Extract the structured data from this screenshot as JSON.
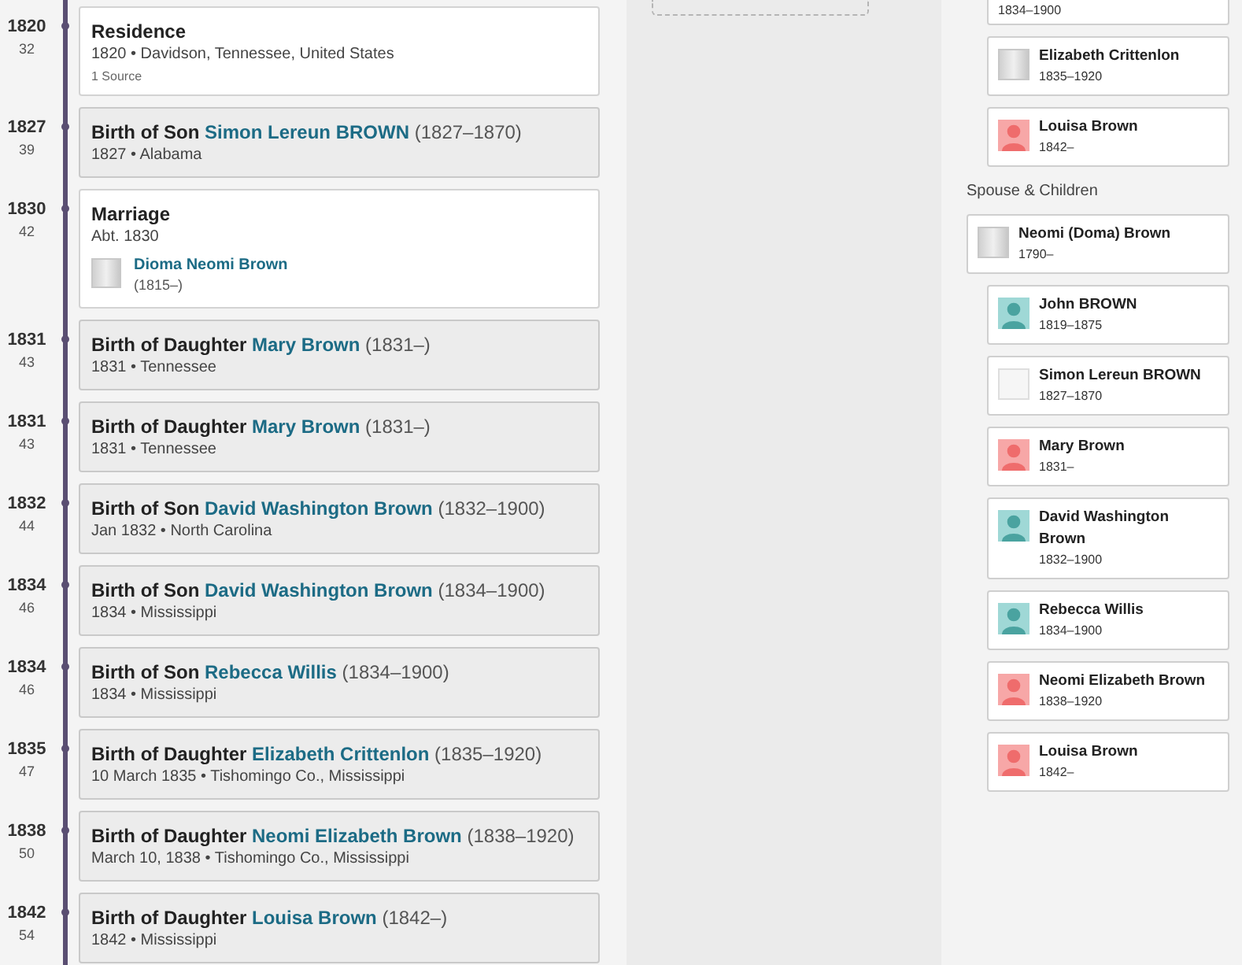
{
  "timeline": [
    {
      "year": "1820",
      "age": "32",
      "kind": "residence",
      "title": "Residence",
      "detail": "1820 • Davidson, Tennessee, United States",
      "sources": "1 Source"
    },
    {
      "year": "1827",
      "age": "39",
      "kind": "birth",
      "title": "Birth of Son",
      "person": "Simon Lereun BROWN",
      "years": "(1827–1870)",
      "detail": "1827 • Alabama"
    },
    {
      "year": "1830",
      "age": "42",
      "kind": "marriage",
      "title": "Marriage",
      "detail": "Abt. 1830",
      "spouse": {
        "name": "Dioma Neomi Brown",
        "years": "(1815–)",
        "kind": "photo"
      }
    },
    {
      "year": "1831",
      "age": "43",
      "kind": "birth",
      "title": "Birth of Daughter",
      "person": "Mary Brown",
      "years": "(1831–)",
      "detail": "1831 • Tennessee"
    },
    {
      "year": "1831",
      "age": "43",
      "kind": "birth",
      "title": "Birth of Daughter",
      "person": "Mary Brown",
      "years": "(1831–)",
      "detail": "1831 • Tennessee"
    },
    {
      "year": "1832",
      "age": "44",
      "kind": "birth",
      "title": "Birth of Son",
      "person": "David Washington Brown",
      "years": "(1832–1900)",
      "detail": "Jan 1832 • North Carolina"
    },
    {
      "year": "1834",
      "age": "46",
      "kind": "birth",
      "title": "Birth of Son",
      "person": "David Washington Brown",
      "years": "(1834–1900)",
      "detail": "1834 • Mississippi"
    },
    {
      "year": "1834",
      "age": "46",
      "kind": "birth",
      "title": "Birth of Son",
      "person": "Rebecca Willis",
      "years": "(1834–1900)",
      "detail": "1834 • Mississippi"
    },
    {
      "year": "1835",
      "age": "47",
      "kind": "birth",
      "title": "Birth of Daughter",
      "person": "Elizabeth Crittenlon",
      "years": "(1835–1920)",
      "detail": "10 March 1835 • Tishomingo Co., Mississippi"
    },
    {
      "year": "1838",
      "age": "50",
      "kind": "birth",
      "title": "Birth of Daughter",
      "person": "Neomi Elizabeth Brown",
      "years": "(1838–1920)",
      "detail": "March 10, 1838 • Tishomingo Co., Mississippi"
    },
    {
      "year": "1842",
      "age": "54",
      "kind": "birth",
      "title": "Birth of Daughter",
      "person": "Louisa Brown",
      "years": "(1842–)",
      "detail": "1842 • Mississippi"
    }
  ],
  "family": {
    "siblings": [
      {
        "years": "1834–1900",
        "partial": true
      },
      {
        "name": "Elizabeth Crittenlon",
        "years": "1835–1920",
        "kind": "photo"
      },
      {
        "name": "Louisa Brown",
        "years": "1842–",
        "kind": "female"
      }
    ],
    "spouse_heading": "Spouse & Children",
    "spouse": {
      "name": "Neomi (Doma) Brown",
      "years": "1790–",
      "kind": "photo"
    },
    "children": [
      {
        "name": "John BROWN",
        "years": "1819–1875",
        "kind": "male"
      },
      {
        "name": "Simon Lereun BROWN",
        "years": "1827–1870",
        "kind": "blank"
      },
      {
        "name": "Mary Brown",
        "years": "1831–",
        "kind": "female"
      },
      {
        "name": "David Washington Brown",
        "years": "1832–1900",
        "kind": "male"
      },
      {
        "name": "Rebecca Willis",
        "years": "1834–1900",
        "kind": "male"
      },
      {
        "name": "Neomi Elizabeth Brown",
        "years": "1838–1920",
        "kind": "female"
      },
      {
        "name": "Louisa Brown",
        "years": "1842–",
        "kind": "female"
      }
    ]
  }
}
